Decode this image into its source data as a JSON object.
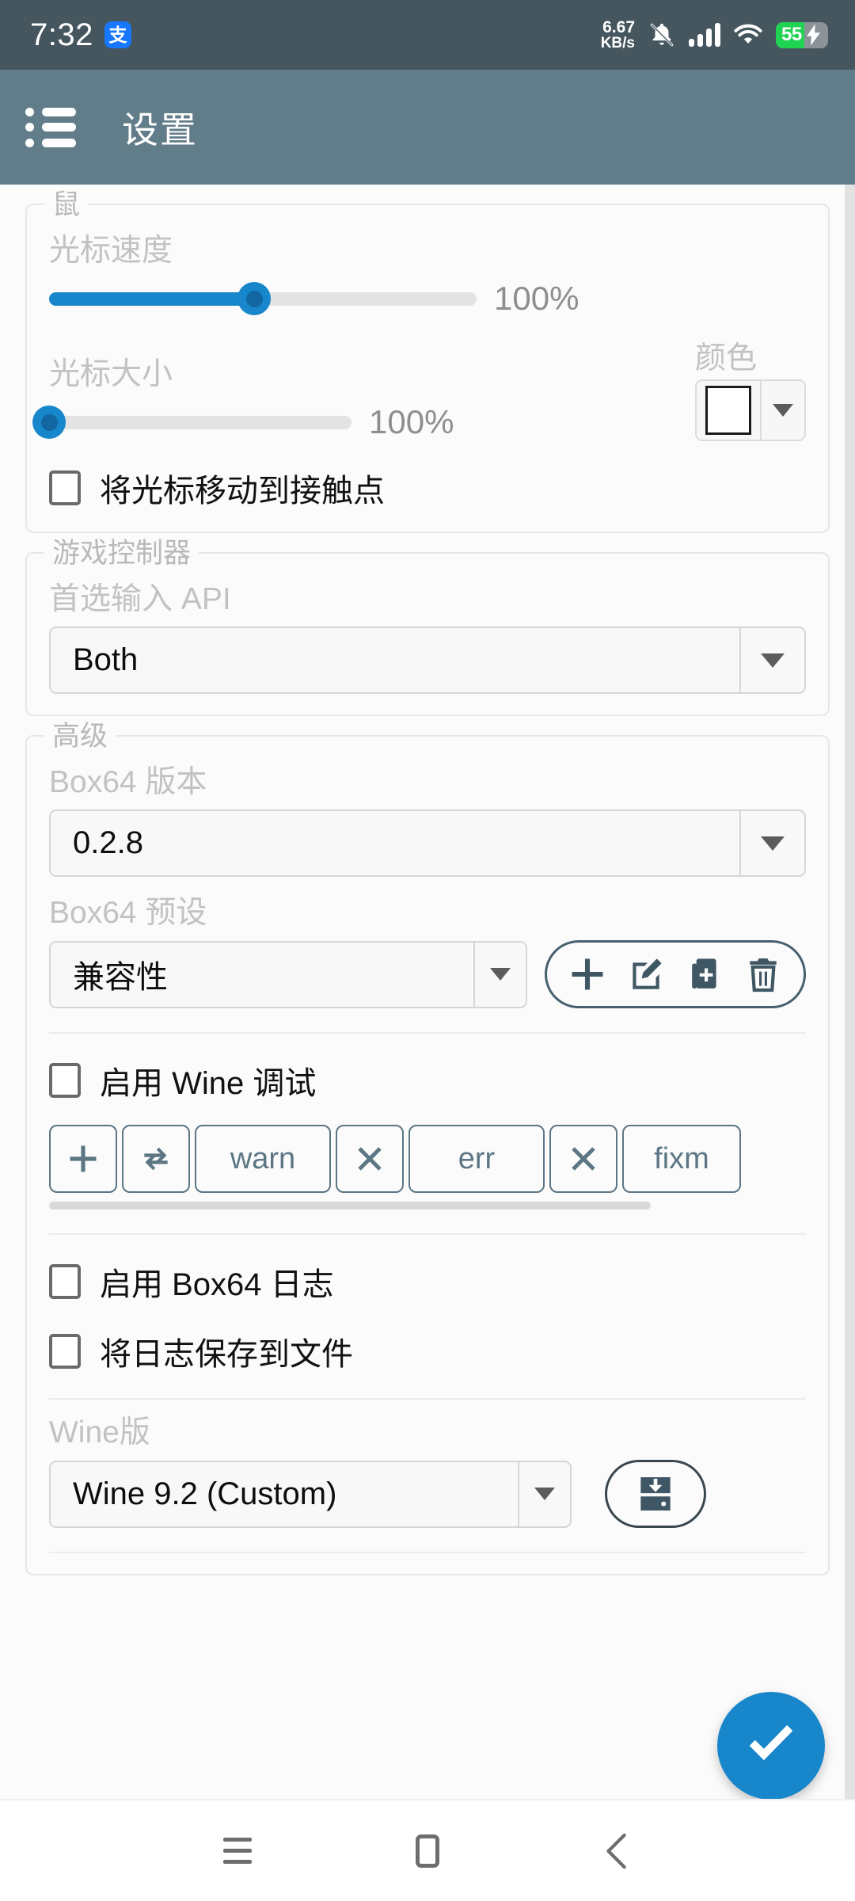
{
  "statusbar": {
    "time": "7:32",
    "app_badge": "支",
    "net_speed_value": "6.67",
    "net_speed_unit": "KB/s",
    "bell_icon": "bell-muted-icon",
    "signal_icon": "signal-bars-icon",
    "wifi_icon": "wifi-icon",
    "battery_percent": "55",
    "battery_charging": true,
    "bar_color": "#46565e"
  },
  "appbar": {
    "menu_icon": "list-menu-icon",
    "title": "设置",
    "bar_color": "#627d8a"
  },
  "sections": {
    "mouse": {
      "title": "鼠",
      "cursor_speed": {
        "label": "光标速度",
        "value": "100%",
        "fill_percent": 48
      },
      "cursor_size": {
        "label": "光标大小",
        "value": "100%",
        "fill_percent": 0
      },
      "color": {
        "label": "颜色",
        "swatch_hex": "#ffffff"
      },
      "move_to_touch": {
        "label": "将光标移动到接触点",
        "checked": false
      }
    },
    "gamepad": {
      "title": "游戏控制器",
      "preferred_api": {
        "label": "首选输入 API",
        "value": "Both"
      }
    },
    "advanced": {
      "title": "高级",
      "box64_version": {
        "label": "Box64 版本",
        "value": "0.2.8"
      },
      "box64_preset": {
        "label": "Box64 预设",
        "value": "兼容性",
        "actions": [
          "add-icon",
          "edit-icon",
          "duplicate-icon",
          "delete-icon"
        ]
      },
      "wine_debug": {
        "label": "启用 Wine 调试",
        "checked": false
      },
      "debug_chips": [
        {
          "kind": "icon",
          "icon": "plus-icon",
          "label": "+"
        },
        {
          "kind": "icon",
          "icon": "refresh-icon",
          "label": ""
        },
        {
          "kind": "text",
          "label": "warn"
        },
        {
          "kind": "x",
          "label": "✕"
        },
        {
          "kind": "text",
          "label": "err"
        },
        {
          "kind": "x",
          "label": "✕"
        },
        {
          "kind": "text",
          "label": "fixm"
        }
      ],
      "box64_log": {
        "label": "启用 Box64 日志",
        "checked": false
      },
      "save_log_to_file": {
        "label": "将日志保存到文件",
        "checked": false
      },
      "wine_version": {
        "label": "Wine版",
        "value": "Wine 9.2 (Custom)"
      },
      "install_button_icon": "save-download-icon"
    }
  },
  "fab": {
    "icon": "check-icon",
    "color": "#1786cb"
  },
  "navbar": {
    "recents": "recents-icon",
    "home": "home-icon",
    "back": "back-icon"
  }
}
